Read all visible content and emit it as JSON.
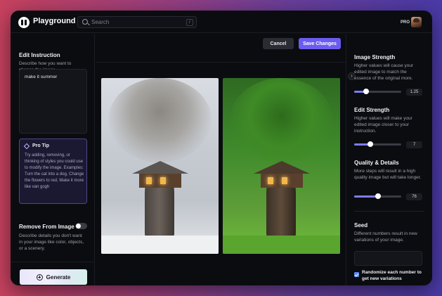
{
  "header": {
    "brand": "Playground",
    "search_placeholder": "Search",
    "search_shortcut": "/",
    "plan_badge": "PRO"
  },
  "left": {
    "edit_title": "Edit Instruction",
    "edit_desc": "Describe how you want to change the image.",
    "instruction_value": "make it summer",
    "tip_title": "Pro Tip",
    "tip_body": "Try adding, removing, or thinking of styles you could use to modify the image. Examples: Turn the cat into a dog, Change the flowers to red, Make it more like van gogh",
    "remove_title": "Remove From Image",
    "remove_desc": "Describe details you don't want in your image like color, objects, or a scenery.",
    "remove_enabled": false,
    "generate_label": "Generate"
  },
  "center": {
    "cancel_label": "Cancel",
    "save_label": "Save Changes",
    "nav_arrow": "›"
  },
  "right": {
    "image_strength": {
      "title": "Image Strength",
      "desc": "Higher values will cause your edited image to match the essence of the original more.",
      "value": "1.25",
      "fraction": 0.25
    },
    "edit_strength": {
      "title": "Edit Strength",
      "desc": "Higher values will make your edited image closer to your instruction.",
      "value": "7",
      "fraction": 0.35
    },
    "quality": {
      "title": "Quality & Details",
      "desc": "More steps will result in a high quality image but will take longer.",
      "value": "76",
      "fraction": 0.5
    },
    "seed": {
      "title": "Seed",
      "desc": "Different numbers result in new variations of your image.",
      "value": ""
    },
    "randomize_label": "Randomize each number to get new variations",
    "randomize_checked": true
  },
  "colors": {
    "accent": "#6b5cf0",
    "slider_fill": "#7d7cf6",
    "tip_border": "#4b4a8a"
  }
}
